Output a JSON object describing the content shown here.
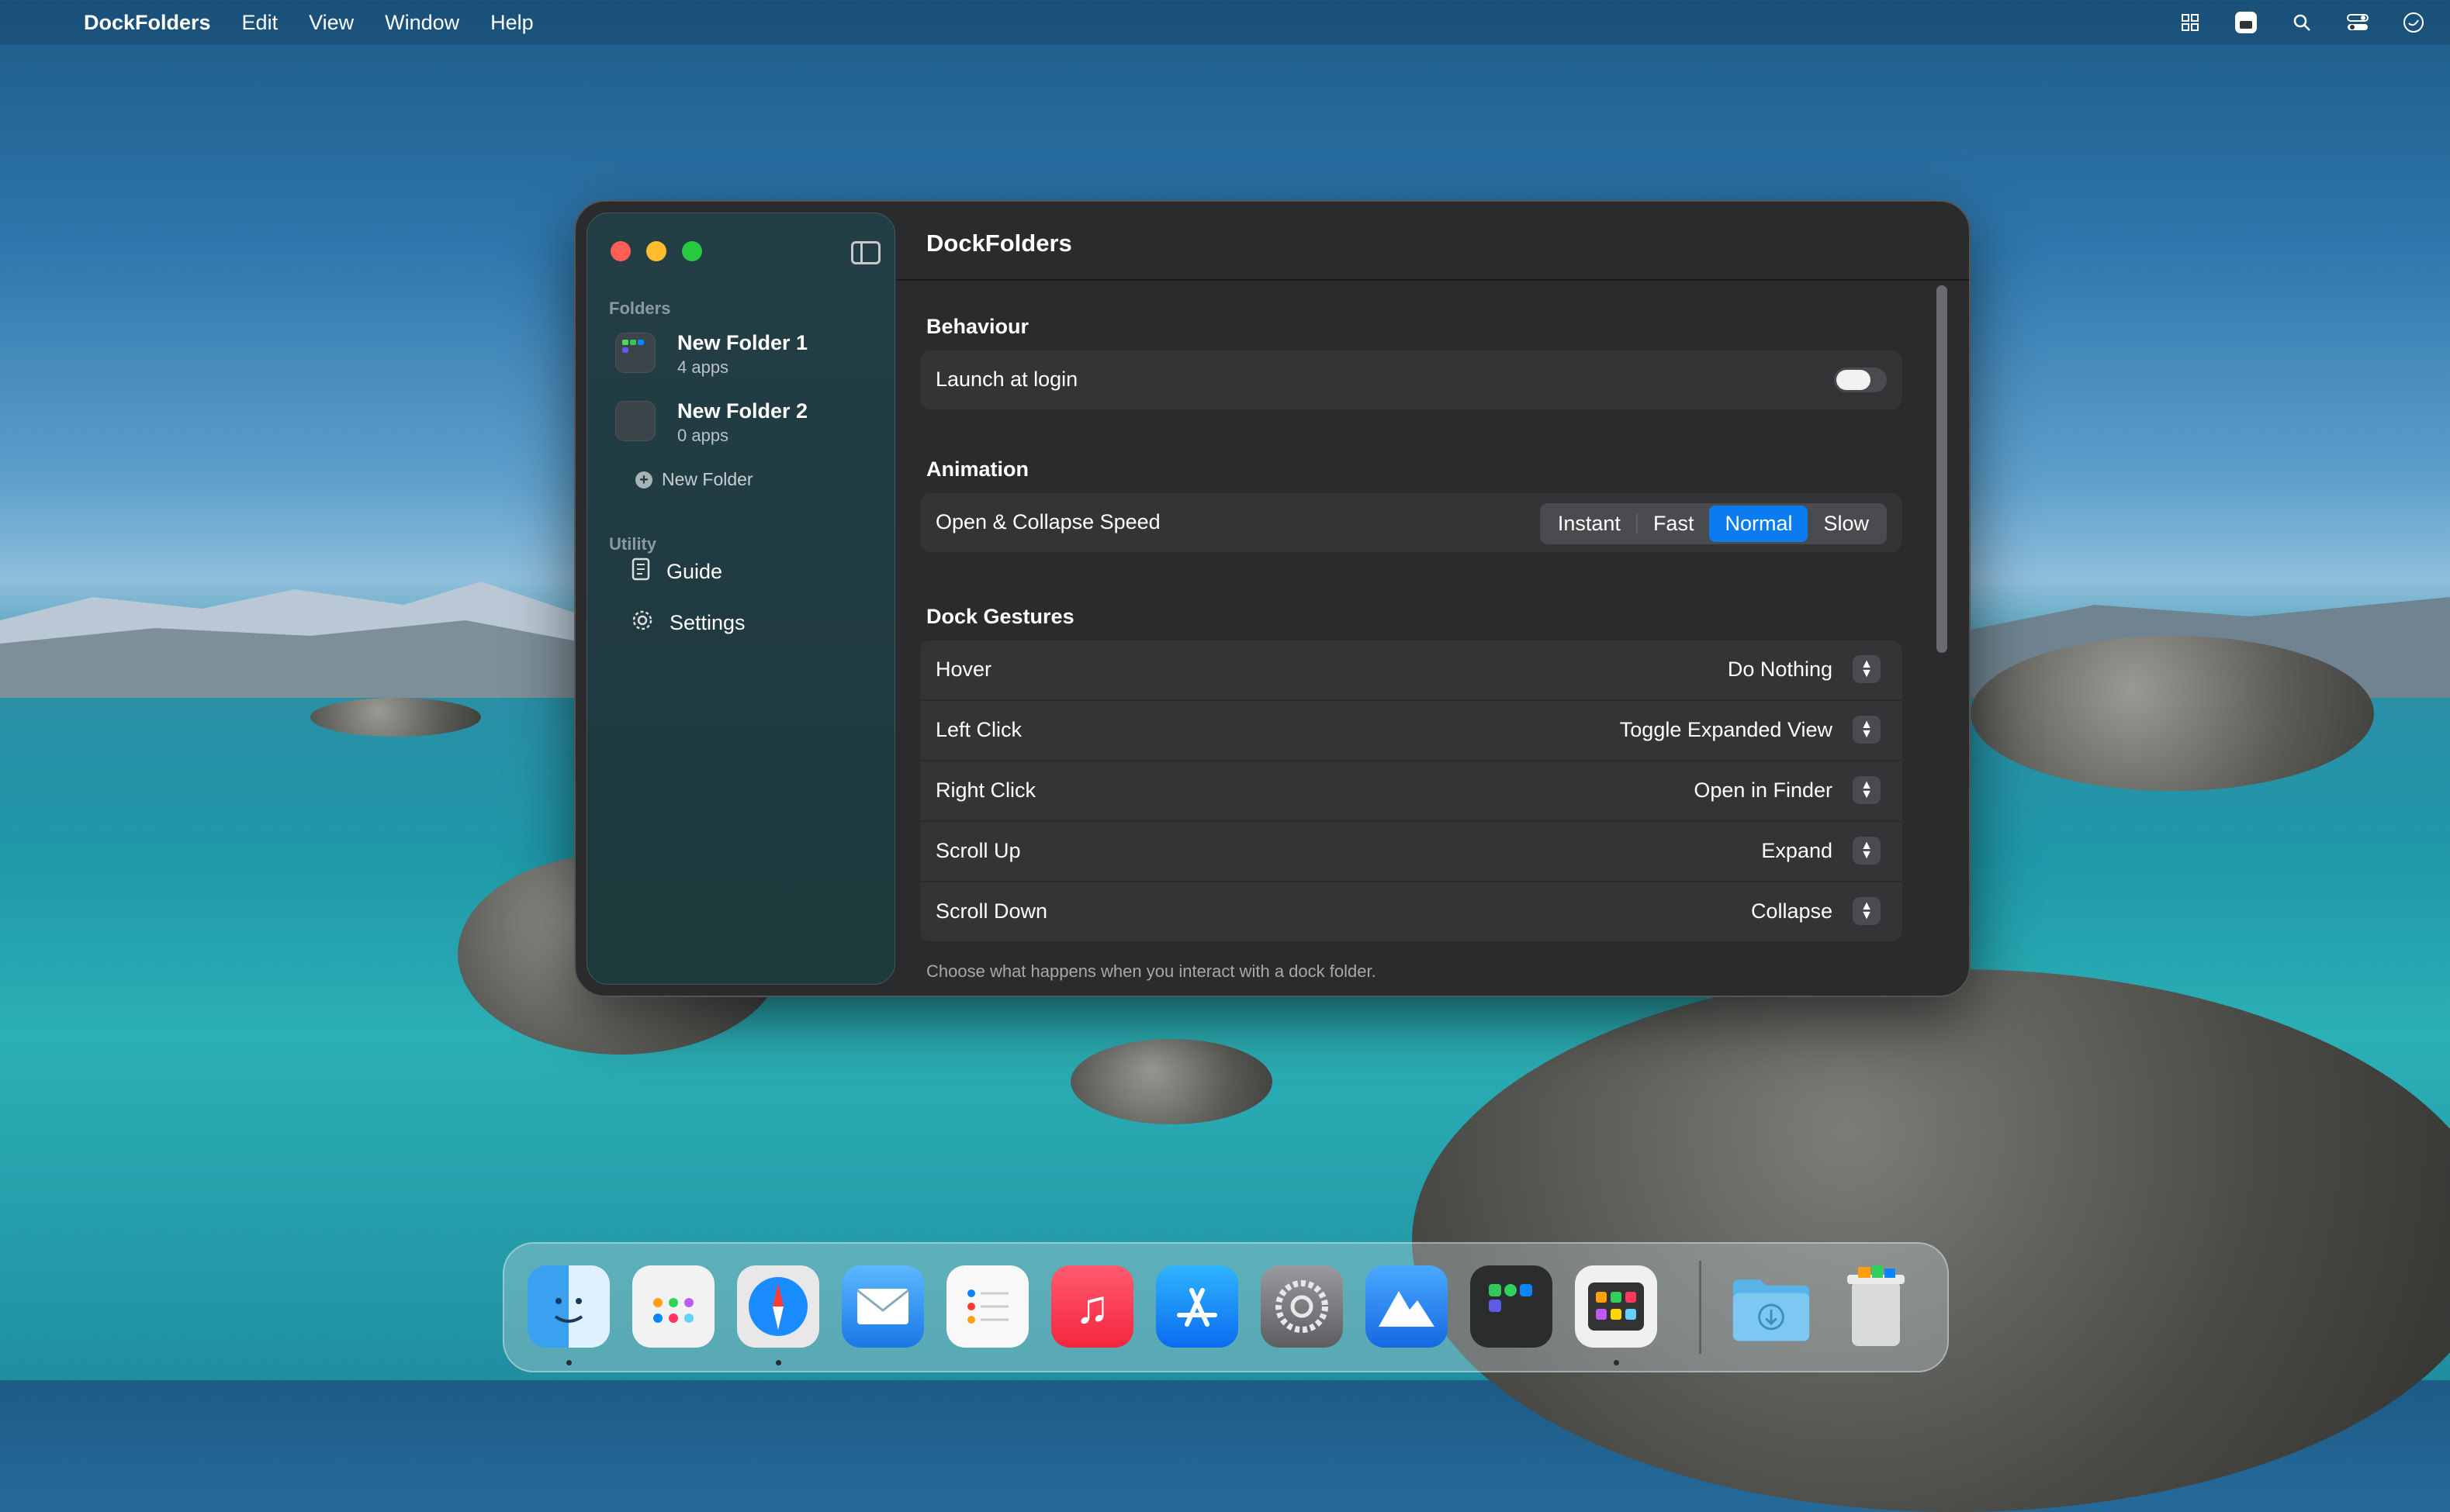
{
  "menubar": {
    "app_name": "DockFolders",
    "menus": [
      "Edit",
      "View",
      "Window",
      "Help"
    ],
    "right_icons": [
      "window-grid-icon",
      "dockfolders-status-icon",
      "search-icon",
      "control-center-icon",
      "siri-icon"
    ]
  },
  "window": {
    "title": "DockFolders",
    "sidebar": {
      "folders_label": "Folders",
      "folders": [
        {
          "name": "New Folder 1",
          "count": "4 apps"
        },
        {
          "name": "New Folder 2",
          "count": "0 apps"
        }
      ],
      "new_folder_label": "New Folder",
      "utility_label": "Utility",
      "utility_items": [
        {
          "label": "Guide",
          "icon": "guide-icon"
        },
        {
          "label": "Settings",
          "icon": "gear-icon"
        }
      ]
    },
    "behaviour": {
      "heading": "Behaviour",
      "launch_at_login_label": "Launch at login",
      "launch_at_login": false
    },
    "animation": {
      "heading": "Animation",
      "speed_label": "Open & Collapse Speed",
      "options": [
        "Instant",
        "Fast",
        "Normal",
        "Slow"
      ],
      "selected": "Normal"
    },
    "gestures": {
      "heading": "Dock Gestures",
      "rows": [
        {
          "label": "Hover",
          "value": "Do Nothing"
        },
        {
          "label": "Left Click",
          "value": "Toggle Expanded View"
        },
        {
          "label": "Right Click",
          "value": "Open in Finder"
        },
        {
          "label": "Scroll Up",
          "value": "Expand"
        },
        {
          "label": "Scroll Down",
          "value": "Collapse"
        }
      ],
      "footnote": "Choose what happens when you interact with a dock folder."
    }
  },
  "dock": {
    "apps": [
      "finder-icon",
      "launchpad-icon",
      "safari-icon",
      "mail-icon",
      "reminders-icon",
      "music-icon",
      "app-store-icon",
      "system-settings-icon",
      "dockfolders-icon",
      "folder-group-icon",
      "launcher-icon",
      "downloads-folder-icon",
      "trash-icon"
    ],
    "accent": "#0a7cf0"
  }
}
